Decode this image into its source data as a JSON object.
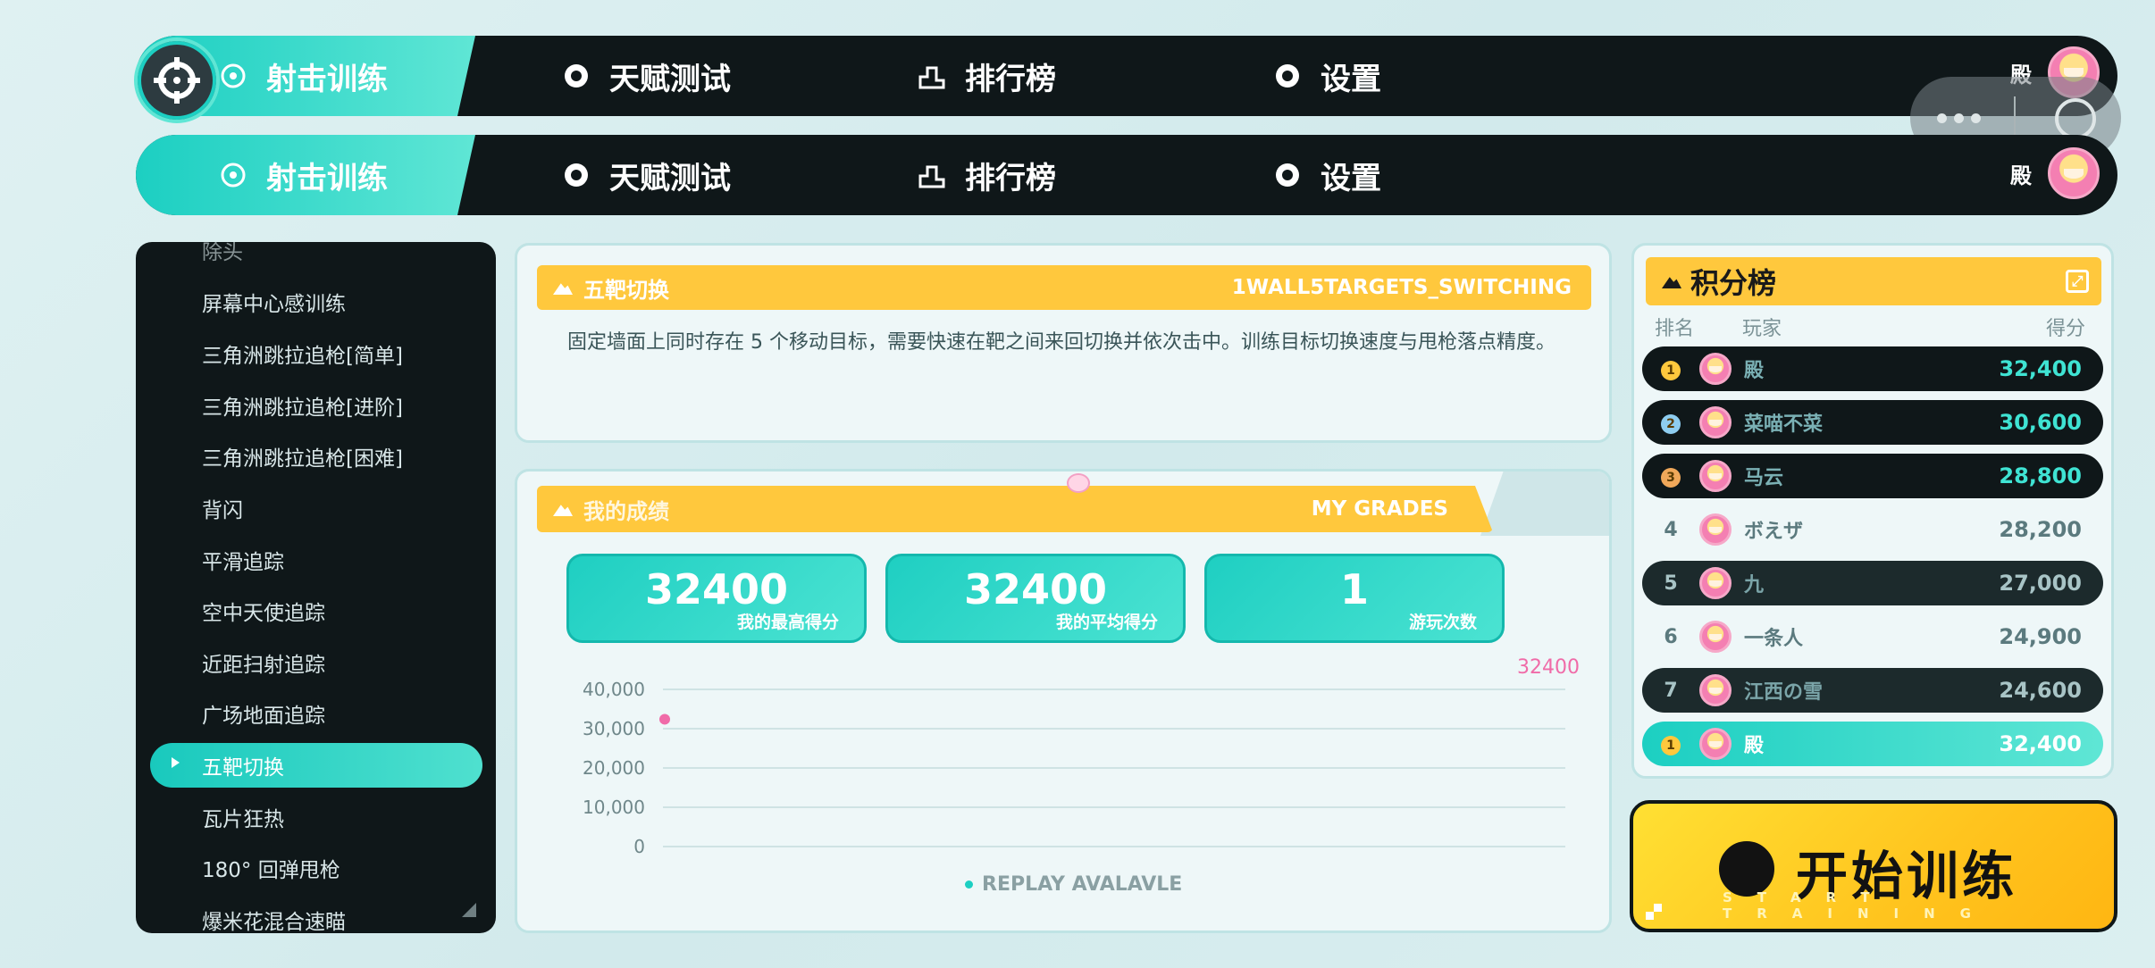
{
  "nav": {
    "items": [
      {
        "label": "射击训练"
      },
      {
        "label": "天赋测试"
      },
      {
        "label": "排行榜"
      },
      {
        "label": "设置"
      }
    ],
    "user_name": "殿"
  },
  "sidebar": {
    "partial_top": "除头",
    "items": [
      "屏幕中心感训练",
      "三角洲跳拉追枪[简单]",
      "三角洲跳拉追枪[进阶]",
      "三角洲跳拉追枪[困难]",
      "背闪",
      "平滑追踪",
      "空中天使追踪",
      "近距扫射追踪",
      "广场地面追踪",
      "五靶切换",
      "瓦片狂热",
      "180° 回弹甩枪",
      "爆米花混合速瞄"
    ],
    "active_index": 9
  },
  "task": {
    "title": "五靶切换",
    "code": "1WALL5TARGETS_SWITCHING",
    "description": "固定墙面上同时存在 5 个移动目标，需要快速在靶之间来回切换并依次击中。训练目标切换速度与甩枪落点精度。"
  },
  "grades": {
    "title": "我的成绩",
    "title_en": "MY GRADES",
    "stats": [
      {
        "value": "32400",
        "label": "我的最高得分"
      },
      {
        "value": "32400",
        "label": "我的平均得分"
      },
      {
        "value": "1",
        "label": "游玩次数"
      }
    ],
    "replay_label": "REPLAY AVALAVLE"
  },
  "chart_data": {
    "type": "scatter",
    "y_ticks": [
      "40,000",
      "30,000",
      "20,000",
      "10,000",
      "0"
    ],
    "ylim": [
      0,
      40000
    ],
    "points": [
      {
        "x": 1,
        "y": 32400
      }
    ],
    "top_label": "32400",
    "color": "#f06ba8"
  },
  "leaderboard": {
    "title": "积分榜",
    "col_rank": "排名",
    "col_player": "玩家",
    "col_score": "得分",
    "rows": [
      {
        "rank": "1",
        "name": "殿",
        "score": "32,400",
        "style": "dark",
        "medal": "gold"
      },
      {
        "rank": "2",
        "name": "菜喵不菜",
        "score": "30,600",
        "style": "dark",
        "medal": "silver"
      },
      {
        "rank": "3",
        "name": "马云",
        "score": "28,800",
        "style": "dark",
        "medal": "bronze"
      },
      {
        "rank": "4",
        "name": "ボえザ",
        "score": "28,200",
        "style": "light"
      },
      {
        "rank": "5",
        "name": "九",
        "score": "27,000",
        "style": "darkgray"
      },
      {
        "rank": "6",
        "name": "一条人",
        "score": "24,900",
        "style": "light"
      },
      {
        "rank": "7",
        "name": "江西の雪",
        "score": "24,600",
        "style": "darkgray"
      },
      {
        "rank": "1",
        "name": "殿",
        "score": "32,400",
        "style": "self",
        "medal": "gold"
      }
    ]
  },
  "start": {
    "label": "开始训练",
    "sub": "START TRAINING"
  },
  "colors": {
    "accent": "#1ccfc2",
    "yellow": "#ffc83d",
    "dark": "#0f1719",
    "pink": "#f06ba8"
  }
}
